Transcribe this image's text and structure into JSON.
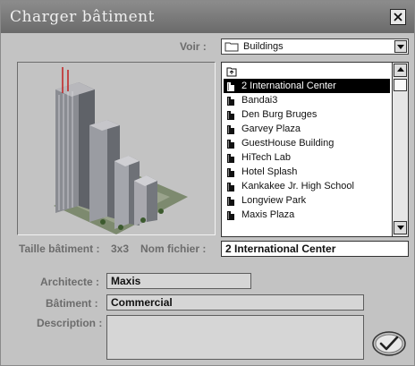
{
  "window": {
    "title": "Charger bâtiment"
  },
  "view": {
    "label": "Voir :",
    "value": "Buildings"
  },
  "list": {
    "items": [
      {
        "label": "2 International Center",
        "selected": true
      },
      {
        "label": "Bandai3"
      },
      {
        "label": "Den Burg Bruges"
      },
      {
        "label": "Garvey Plaza"
      },
      {
        "label": "GuestHouse Building"
      },
      {
        "label": "HiTech Lab"
      },
      {
        "label": "Hotel Splash"
      },
      {
        "label": "Kankakee Jr. High School"
      },
      {
        "label": "Longview Park"
      },
      {
        "label": "Maxis Plaza"
      }
    ]
  },
  "size": {
    "label": "Taille bâtiment :",
    "value": "3x3"
  },
  "filename": {
    "label": "Nom fichier :",
    "value": "2 International Center"
  },
  "architect": {
    "label": "Architecte :",
    "value": "Maxis"
  },
  "building": {
    "label": "Bâtiment :",
    "value": "Commercial"
  },
  "description": {
    "label": "Description :",
    "value": ""
  },
  "icons": {
    "close": "close-icon",
    "folder": "folder-icon",
    "up": "parent-folder-icon",
    "building": "building-icon",
    "ok": "checkmark-icon"
  }
}
